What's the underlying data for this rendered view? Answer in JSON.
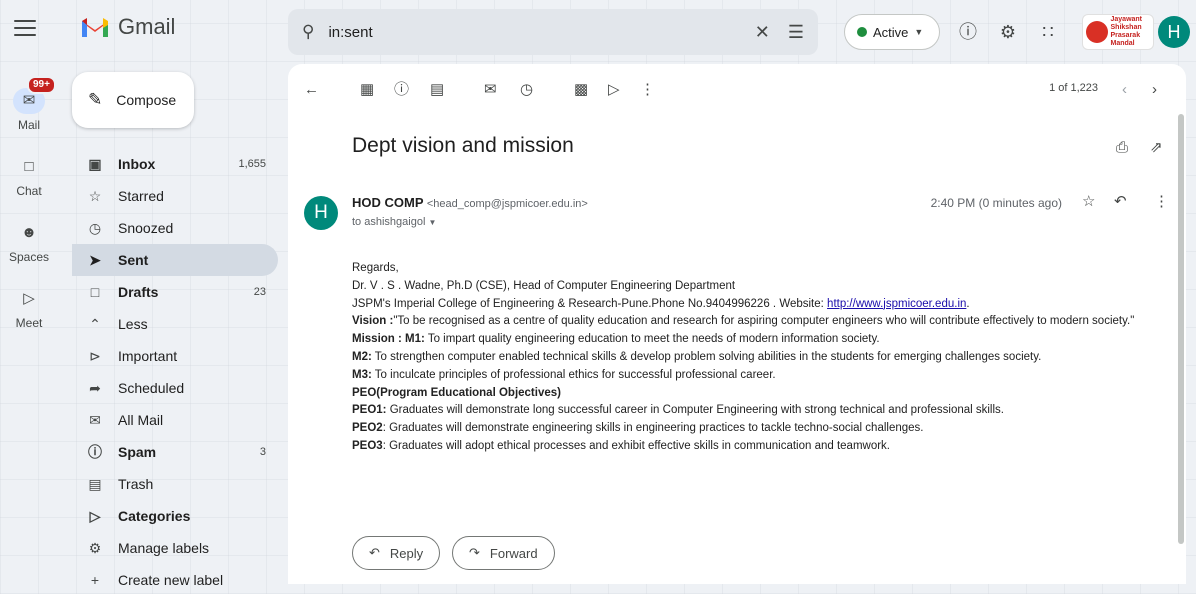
{
  "app": {
    "name": "Gmail"
  },
  "search": {
    "value": "in:sent"
  },
  "status": {
    "label": "Active",
    "color": "#1e8e3e"
  },
  "account": {
    "initial": "H",
    "org_logo_text": "Jayawant Shikshan Prasarak Mandal"
  },
  "rail": [
    {
      "label": "Mail",
      "icon": "mail-icon",
      "badge": "99+"
    },
    {
      "label": "Chat",
      "icon": "chat-icon"
    },
    {
      "label": "Spaces",
      "icon": "spaces-icon"
    },
    {
      "label": "Meet",
      "icon": "meet-icon"
    }
  ],
  "compose": {
    "label": "Compose"
  },
  "nav": [
    {
      "label": "Inbox",
      "count": "1,655",
      "icon": "inbox-icon",
      "bold": true
    },
    {
      "label": "Starred",
      "count": "",
      "icon": "star-icon"
    },
    {
      "label": "Snoozed",
      "count": "",
      "icon": "clock-icon"
    },
    {
      "label": "Sent",
      "count": "",
      "icon": "send-icon",
      "bold": true,
      "selected": true
    },
    {
      "label": "Drafts",
      "count": "23",
      "icon": "draft-icon",
      "bold": true
    },
    {
      "label": "Less",
      "count": "",
      "icon": "chevron-up-icon"
    },
    {
      "label": "Important",
      "count": "",
      "icon": "important-icon"
    },
    {
      "label": "Scheduled",
      "count": "",
      "icon": "scheduled-icon"
    },
    {
      "label": "All Mail",
      "count": "",
      "icon": "all-mail-icon"
    },
    {
      "label": "Spam",
      "count": "3",
      "icon": "spam-icon",
      "bold": true
    },
    {
      "label": "Trash",
      "count": "",
      "icon": "trash-icon"
    },
    {
      "label": "Categories",
      "count": "",
      "icon": "label-icon",
      "bold": true
    },
    {
      "label": "Manage labels",
      "count": "",
      "icon": "gear-icon"
    },
    {
      "label": "Create new label",
      "count": "",
      "icon": "plus-icon"
    }
  ],
  "pager": {
    "text": "1 of 1,223"
  },
  "email": {
    "subject": "Dept vision and mission",
    "sender_name": "HOD COMP",
    "sender_email": "<head_comp@jspmicoer.edu.in>",
    "to": "to ashishgaigol",
    "time": "2:40 PM (0 minutes ago)",
    "avatar_initial": "H",
    "regards": "Regards,",
    "signature_name": "Dr. V . S . Wadne, Ph.D (CSE), Head of Computer Engineering Department",
    "signature_college": "JSPM's Imperial College of Engineering & Research-Pune.Phone No.9404996226 . Website: ",
    "website": "http://www.jspmicoer.edu.in",
    "website_suffix": ".",
    "vision_label": "Vision :",
    "vision_text": "\"To be recognised as a centre of quality education and research for aspiring computer engineers who will contribute effectively to modern society.\"",
    "mission_label": " Mission : M1:",
    "mission_m1": " To impart quality engineering education to meet  the needs of modern information society.",
    "m2_label": " M2:",
    "m2_text": " To strengthen computer enabled technical skills & develop problem solving abilities in the students for emerging challenges society.",
    "m3_label": " M3:",
    "m3_text": " To inculcate principles of professional ethics for successful professional career.",
    "peo_heading": "PEO(Program Educational Objectives)",
    "peo1_label": "PEO1:",
    "peo1_text": " Graduates will demonstrate long successful career in Computer Engineering with strong technical and professional skills.",
    "peo2_label": "PEO2",
    "peo2_text": ": Graduates will demonstrate engineering skills in engineering practices to tackle techno-social challenges.",
    "peo3_label": "PEO3",
    "peo3_text": ": Graduates will adopt ethical processes and exhibit effective skills in communication and teamwork."
  },
  "actions": {
    "reply": "Reply",
    "forward": "Forward"
  }
}
